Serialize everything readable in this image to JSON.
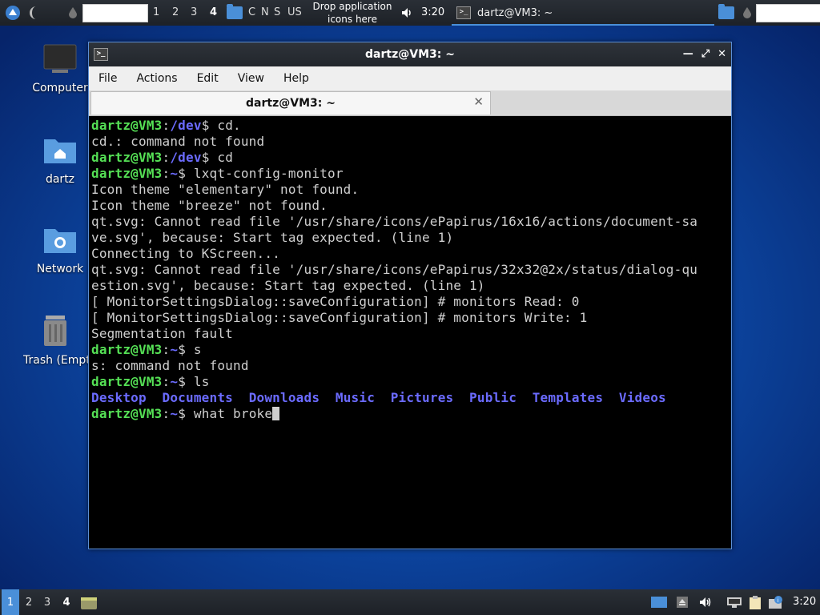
{
  "top_panel": {
    "desktops": [
      "1",
      "2",
      "3",
      "4"
    ],
    "active_desktop": "4",
    "keyboard_indicators": [
      "C",
      "N",
      "S"
    ],
    "keyboard_layout": "US",
    "drop_text_line1": "Drop application",
    "drop_text_line2": "icons here",
    "clock": "3:20",
    "task_title": "dartz@VM3: ~"
  },
  "desktop_icons": [
    {
      "label": "Computer"
    },
    {
      "label": "dartz"
    },
    {
      "label": "Network"
    },
    {
      "label": "Trash (Empty)"
    }
  ],
  "window": {
    "title": "dartz@VM3: ~",
    "menu": [
      "File",
      "Actions",
      "Edit",
      "View",
      "Help"
    ],
    "tab_title": "dartz@VM3: ~",
    "prompt_user": "dartz@VM3",
    "lines": [
      {
        "type": "prompt",
        "path": "/dev",
        "cmd": " cd."
      },
      {
        "type": "out",
        "text": "cd.: command not found"
      },
      {
        "type": "prompt",
        "path": "/dev",
        "cmd": " cd"
      },
      {
        "type": "prompt",
        "path": "~",
        "cmd": " lxqt-config-monitor"
      },
      {
        "type": "out",
        "text": "Icon theme \"elementary\" not found."
      },
      {
        "type": "out",
        "text": "Icon theme \"breeze\" not found."
      },
      {
        "type": "out",
        "text": "qt.svg: Cannot read file '/usr/share/icons/ePapirus/16x16/actions/document-sa"
      },
      {
        "type": "out",
        "text": "ve.svg', because: Start tag expected. (line 1)"
      },
      {
        "type": "out",
        "text": "Connecting to KScreen..."
      },
      {
        "type": "out",
        "text": "qt.svg: Cannot read file '/usr/share/icons/ePapirus/32x32@2x/status/dialog-qu"
      },
      {
        "type": "out",
        "text": "estion.svg', because: Start tag expected. (line 1)"
      },
      {
        "type": "out",
        "text": "[ MonitorSettingsDialog::saveConfiguration] # monitors Read: 0"
      },
      {
        "type": "out",
        "text": "[ MonitorSettingsDialog::saveConfiguration] # monitors Write: 1"
      },
      {
        "type": "out",
        "text": "Segmentation fault"
      },
      {
        "type": "prompt",
        "path": "~",
        "cmd": " s"
      },
      {
        "type": "out",
        "text": "s: command not found"
      },
      {
        "type": "prompt",
        "path": "~",
        "cmd": " ls"
      },
      {
        "type": "dirs",
        "items": [
          "Desktop",
          "Documents",
          "Downloads",
          "Music",
          "Pictures",
          "Public",
          "Templates",
          "Videos"
        ]
      },
      {
        "type": "current",
        "path": "~",
        "cmd": " what broke"
      }
    ]
  },
  "bottom_panel": {
    "desktops": [
      "1",
      "2",
      "3",
      "4"
    ],
    "active_desktop": "1",
    "clock": "3:20"
  },
  "colors": {
    "prompt_user": "#55e055",
    "prompt_path": "#6b6bff",
    "accent": "#4a8fd8"
  }
}
